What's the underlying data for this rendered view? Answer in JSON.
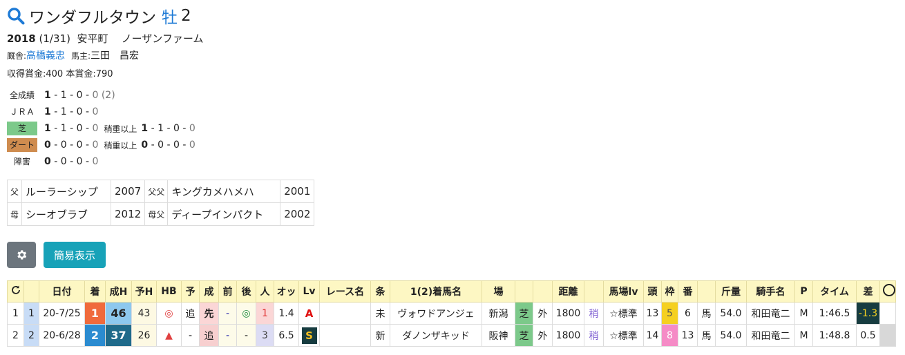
{
  "header": {
    "name": "ワンダフルタウン",
    "sex": "牡",
    "age": "2"
  },
  "profile": {
    "birth_year": "2018",
    "birth_date": "(1/31)",
    "birthplace": "安平町",
    "breeder": "ノーザンファーム",
    "stable_label": "厩舎:",
    "trainer": "高橋義忠",
    "owner_label": "馬主:",
    "owner": "三田　昌宏",
    "earn_label1": "収得賞金:",
    "earn_value1": "400",
    "earn_label2": "本賞金:",
    "earn_value2": "790"
  },
  "records": {
    "all_label": "全成績",
    "all": [
      "1",
      "1",
      "0",
      "0"
    ],
    "all_extra": "(2)",
    "jra_label": "ＪＲＡ",
    "jra": [
      "1",
      "1",
      "0",
      "0"
    ],
    "turf_label": "芝",
    "turf": [
      "1",
      "1",
      "0",
      "0"
    ],
    "turf_heavy_label": "稍重以上",
    "turf_heavy": [
      "1",
      "1",
      "0",
      "0"
    ],
    "dirt_label": "ダート",
    "dirt": [
      "0",
      "0",
      "0",
      "0"
    ],
    "dirt_heavy_label": "稍重以上",
    "dirt_heavy": [
      "0",
      "0",
      "0",
      "0"
    ],
    "jump_label": "障害",
    "jump": [
      "0",
      "0",
      "0",
      "0"
    ]
  },
  "pedigree": {
    "rows": [
      {
        "k1": "父",
        "v1": "ルーラーシップ",
        "y1": "2007",
        "k2": "父父",
        "v2": "キングカメハメハ",
        "y2": "2001"
      },
      {
        "k1": "母",
        "v1": "シーオブラブ",
        "y1": "2012",
        "k2": "母父",
        "v2": "ディープインパクト",
        "y2": "2002"
      }
    ]
  },
  "buttons": {
    "settings_icon": "gear-icon",
    "simple_view": "簡易表示"
  },
  "races": {
    "headers": [
      "",
      "日付",
      "着",
      "成H",
      "予H",
      "HB",
      "予",
      "成",
      "前",
      "後",
      "人",
      "オッ",
      "Lv",
      "レース名",
      "条",
      "1(2)着馬名",
      "場",
      "",
      "",
      "距離",
      "",
      "馬場lv",
      "頭",
      "枠",
      "番",
      "",
      "斤量",
      "騎手名",
      "P",
      "タイム",
      "差"
    ],
    "rows": [
      {
        "no": "1",
        "idx": "1",
        "date": "20-7/25",
        "chaku": "1",
        "sei_h": "46",
        "yo_h": "43",
        "hb": "◎",
        "yo": "追",
        "sei": "先",
        "mae": "-",
        "ato": "◎",
        "ninki": "1",
        "odds": "1.4",
        "lv": "A",
        "race_name": "",
        "cond": "未",
        "horse": "ヴォワドアンジェ",
        "place": "新潟",
        "surface": "芝",
        "course": "外",
        "dist": "1800",
        "baba": "稍",
        "baba_lv": "☆標準",
        "heads": "13",
        "waku": "5",
        "ban": "6",
        "sex": "馬",
        "kin": "54.0",
        "jockey": "和田竜二",
        "p": "M",
        "time": "1:46.5",
        "sa": "-1.3"
      },
      {
        "no": "2",
        "idx": "2",
        "date": "20-6/28",
        "chaku": "2",
        "sei_h": "37",
        "yo_h": "26",
        "hb": "▲",
        "yo": "-",
        "sei": "追",
        "mae": "-",
        "ato": "-",
        "ninki": "3",
        "odds": "6.5",
        "lv": "S",
        "race_name": "",
        "cond": "新",
        "horse": "ダノンザキッド",
        "place": "阪神",
        "surface": "芝",
        "course": "外",
        "dist": "1800",
        "baba": "稍",
        "baba_lv": "☆標準",
        "heads": "14",
        "waku": "8",
        "ban": "13",
        "sex": "馬",
        "kin": "54.0",
        "jockey": "和田竜二",
        "p": "M",
        "time": "1:48.8",
        "sa": "0.5"
      }
    ]
  }
}
